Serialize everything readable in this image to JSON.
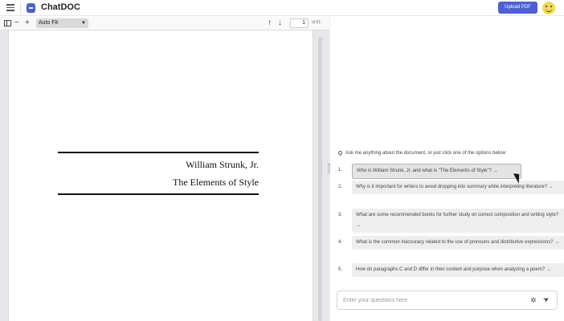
{
  "app": {
    "title": "ChatDOC",
    "upload_label": "Upload PDF",
    "brand_color": "#4c5fd6"
  },
  "toolbar": {
    "zoom_label": "Auto Fit",
    "current_page": "1",
    "total_pages": "of 51",
    "icons": [
      "sidebar-toggle-icon",
      "zoom-out-icon",
      "zoom-in-icon",
      "previous-page-icon",
      "next-page-icon"
    ]
  },
  "pdf": {
    "author": "William Strunk, Jr.",
    "book_title": "The Elements of Style"
  },
  "chat": {
    "prompt": "Ask me anything about the document, or just click one of the options below:",
    "questions": [
      {
        "num": "1.",
        "text": "Who is William Strunk, Jr. and what is \"The Elements of Style\"? →"
      },
      {
        "num": "2.",
        "text": "Why is it important for writers to avoid dropping into summary while interpreting literature? →"
      },
      {
        "num": "3.",
        "text": "What are some recommended books for further study on correct composition and writing style? →"
      },
      {
        "num": "4.",
        "text": "What is the common inaccuracy related to the use of pronouns and distributive expressions? →"
      },
      {
        "num": "5.",
        "text": "How do paragraphs C and D differ in their content and purpose when analyzing a poem? →"
      }
    ],
    "input_placeholder": "Enter your questions here"
  }
}
